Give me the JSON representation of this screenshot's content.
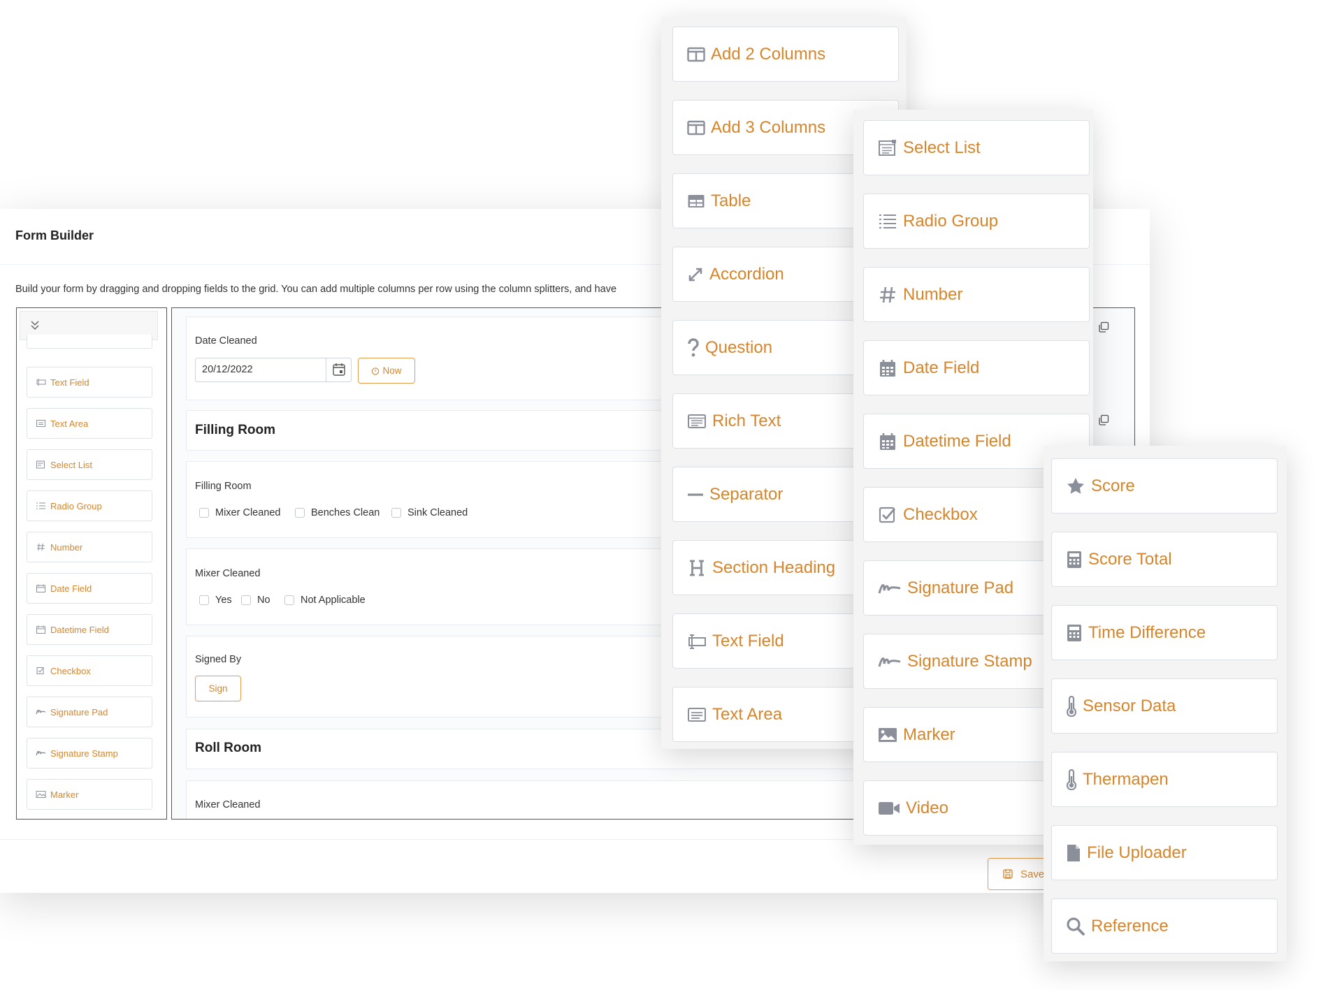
{
  "form_builder": {
    "title": "Form Builder",
    "instructions": "Build your form by dragging and dropping fields to the grid. You can add multiple columns per row using the column splitters, and have",
    "save_label": "Save"
  },
  "sidebar": {
    "items": [
      {
        "label": "Text Field",
        "icon": "text-field-icon"
      },
      {
        "label": "Text Area",
        "icon": "text-area-icon"
      },
      {
        "label": "Select List",
        "icon": "select-list-icon"
      },
      {
        "label": "Radio Group",
        "icon": "radio-group-icon"
      },
      {
        "label": "Number",
        "icon": "hash-icon"
      },
      {
        "label": "Date Field",
        "icon": "calendar-icon"
      },
      {
        "label": "Datetime Field",
        "icon": "calendar-icon"
      },
      {
        "label": "Checkbox",
        "icon": "checkbox-icon"
      },
      {
        "label": "Signature Pad",
        "icon": "signature-icon"
      },
      {
        "label": "Signature Stamp",
        "icon": "signature-icon"
      },
      {
        "label": "Marker",
        "icon": "image-icon"
      }
    ]
  },
  "canvas": {
    "date_cleaned": {
      "label": "Date Cleaned",
      "value": "20/12/2022",
      "now_label": "Now"
    },
    "filling_room_heading": "Filling Room",
    "filling_room_group": {
      "label": "Filling Room",
      "options": [
        "Mixer Cleaned",
        "Benches Clean",
        "Sink Cleaned"
      ]
    },
    "mixer_cleaned_group": {
      "label": "Mixer Cleaned",
      "options": [
        "Yes",
        "No",
        "Not Applicable"
      ]
    },
    "signed_by": {
      "label": "Signed By",
      "sign_label": "Sign"
    },
    "roll_room_heading": "Roll Room",
    "mixer_cleaned_2": {
      "label": "Mixer Cleaned"
    }
  },
  "palette_1": {
    "items": [
      {
        "label": "Add 2 Columns",
        "icon": "columns-icon"
      },
      {
        "label": "Add 3 Columns",
        "icon": "columns-icon"
      },
      {
        "label": "Table",
        "icon": "table-icon"
      },
      {
        "label": "Accordion",
        "icon": "expand-icon"
      },
      {
        "label": "Question",
        "icon": "question-icon"
      },
      {
        "label": "Rich Text",
        "icon": "rich-text-icon"
      },
      {
        "label": "Separator",
        "icon": "minus-icon"
      },
      {
        "label": "Section Heading",
        "icon": "heading-icon"
      },
      {
        "label": "Text Field",
        "icon": "text-field-icon"
      },
      {
        "label": "Text Area",
        "icon": "text-area-icon"
      }
    ]
  },
  "palette_2": {
    "items": [
      {
        "label": "Select List",
        "icon": "select-list-icon"
      },
      {
        "label": "Radio Group",
        "icon": "radio-group-icon"
      },
      {
        "label": "Number",
        "icon": "hash-icon"
      },
      {
        "label": "Date Field",
        "icon": "calendar-icon"
      },
      {
        "label": "Datetime Field",
        "icon": "calendar-icon"
      },
      {
        "label": "Checkbox",
        "icon": "checkbox-icon"
      },
      {
        "label": "Signature Pad",
        "icon": "signature-icon"
      },
      {
        "label": "Signature Stamp",
        "icon": "signature-icon"
      },
      {
        "label": "Marker",
        "icon": "image-icon"
      },
      {
        "label": "Video",
        "icon": "video-icon"
      }
    ]
  },
  "palette_3": {
    "items": [
      {
        "label": "Score",
        "icon": "star-icon"
      },
      {
        "label": "Score Total",
        "icon": "calculator-icon"
      },
      {
        "label": "Time Difference",
        "icon": "calculator-icon"
      },
      {
        "label": "Sensor Data",
        "icon": "thermometer-icon"
      },
      {
        "label": "Thermapen",
        "icon": "thermometer-icon"
      },
      {
        "label": "File Uploader",
        "icon": "file-icon"
      },
      {
        "label": "Reference",
        "icon": "search-icon"
      }
    ]
  },
  "colors": {
    "accent": "#d6852b",
    "icon_gray": "#8a8f99"
  }
}
